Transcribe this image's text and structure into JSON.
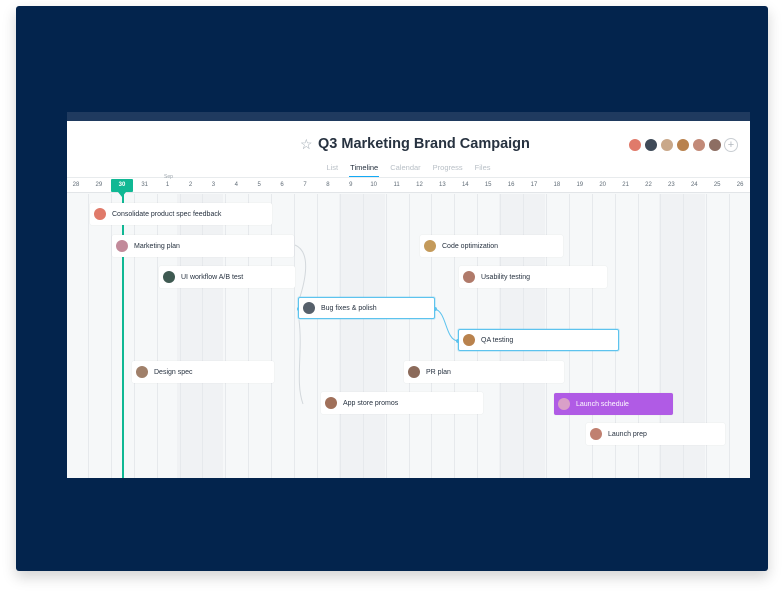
{
  "project": {
    "title": "Q3 Marketing Brand Campaign",
    "star_icon": "☆",
    "add_member_icon": "+"
  },
  "members": [
    {
      "color": "#e07a6a"
    },
    {
      "color": "#3f4a58"
    },
    {
      "color": "#c9a88a"
    },
    {
      "color": "#b9824d"
    },
    {
      "color": "#c28a78"
    },
    {
      "color": "#8d6e63"
    }
  ],
  "tabs": [
    "List",
    "Timeline",
    "Calendar",
    "Progress",
    "Files"
  ],
  "active_tab": "Timeline",
  "timeline": {
    "month_label": "Sep",
    "days": [
      "28",
      "29",
      "30",
      "31",
      "1",
      "2",
      "3",
      "4",
      "5",
      "6",
      "7",
      "8",
      "9",
      "10",
      "11",
      "12",
      "13",
      "14",
      "15",
      "16",
      "17",
      "18",
      "19",
      "20",
      "21",
      "22",
      "23",
      "24",
      "25",
      "26"
    ],
    "today": "30"
  },
  "tasks": [
    {
      "label": "Consolidate product spec feedback",
      "avatar_color": "#e07a6a"
    },
    {
      "label": "Marketing plan",
      "avatar_color": "#c28a9a"
    },
    {
      "label": "UI workflow A/B test",
      "avatar_color": "#3f5a52"
    },
    {
      "label": "Bug fixes & polish",
      "avatar_color": "#56606b"
    },
    {
      "label": "QA testing",
      "avatar_color": "#b9824d"
    },
    {
      "label": "Design spec",
      "avatar_color": "#a0806a"
    },
    {
      "label": "Code optimization",
      "avatar_color": "#c49a5a"
    },
    {
      "label": "Usability testing",
      "avatar_color": "#b07a6a"
    },
    {
      "label": "PR plan",
      "avatar_color": "#8b6a5a"
    },
    {
      "label": "App store promos",
      "avatar_color": "#a0705a"
    },
    {
      "label": "Launch schedule",
      "avatar_color": "#d9a0c8"
    },
    {
      "label": "Launch prep",
      "avatar_color": "#c08070"
    }
  ],
  "colors": {
    "frame": "#03244d",
    "today": "#10b894",
    "selected_border": "#5dc3ee",
    "launch_schedule": "#b05be5"
  }
}
